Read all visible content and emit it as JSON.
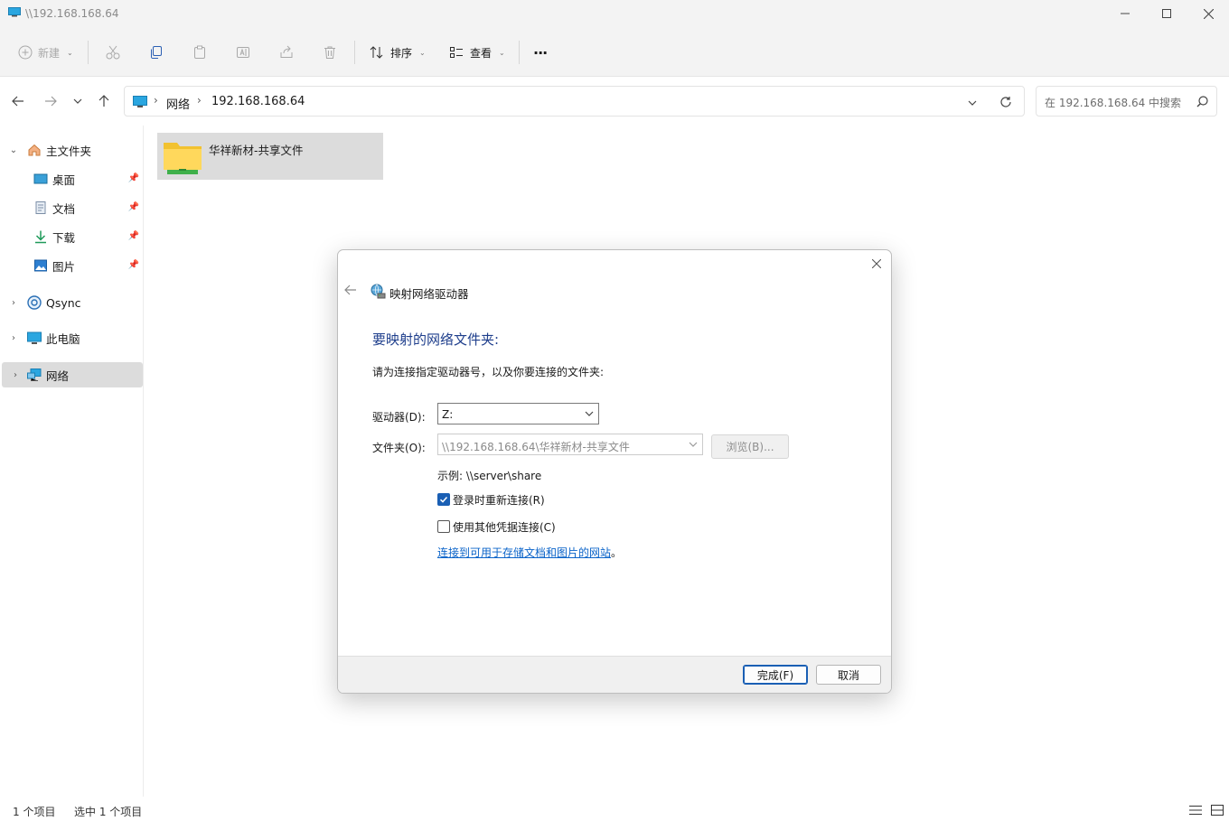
{
  "window": {
    "title": "\\\\192.168.168.64",
    "controls": {
      "minimize": "─",
      "maximize": "☐",
      "close": "✕"
    }
  },
  "toolbar": {
    "new_label": "新建",
    "sort_label": "排序",
    "view_label": "查看",
    "more_label": "···"
  },
  "address": {
    "crumbs": [
      "网络",
      "192.168.168.64"
    ],
    "search_placeholder": "在 192.168.168.64 中搜索"
  },
  "sidebar": {
    "home": "主文件夹",
    "quick": [
      {
        "label": "桌面",
        "icon": "desktop-icon"
      },
      {
        "label": "文档",
        "icon": "documents-icon"
      },
      {
        "label": "下载",
        "icon": "download-icon"
      },
      {
        "label": "图片",
        "icon": "pictures-icon"
      }
    ],
    "qsync": "Qsync",
    "thispc": "此电脑",
    "network": "网络"
  },
  "content": {
    "items": [
      {
        "label": "华祥新材-共享文件",
        "icon": "shared-folder-icon"
      }
    ]
  },
  "status": {
    "count": "1 个项目",
    "selected": "选中 1 个项目"
  },
  "dialog": {
    "title": "映射网络驱动器",
    "heading": "要映射的网络文件夹:",
    "description": "请为连接指定驱动器号，以及你要连接的文件夹:",
    "drive_label": "驱动器(D):",
    "drive_value": "Z:",
    "folder_label": "文件夹(O):",
    "folder_value": "\\\\192.168.168.64\\华祥新材-共享文件",
    "browse_label": "浏览(B)...",
    "example": "示例: \\\\server\\share",
    "reconnect_label": "登录时重新连接(R)",
    "reconnect_checked": true,
    "credentials_label": "使用其他凭据连接(C)",
    "credentials_checked": false,
    "link_text": "连接到可用于存储文档和图片的网站",
    "link_suffix": "。",
    "finish_label": "完成(F)",
    "cancel_label": "取消"
  },
  "colors": {
    "accent": "#1a5fb4",
    "heading": "#1e3e8c",
    "link": "#0a63c9",
    "selection": "#dcdcdc"
  }
}
